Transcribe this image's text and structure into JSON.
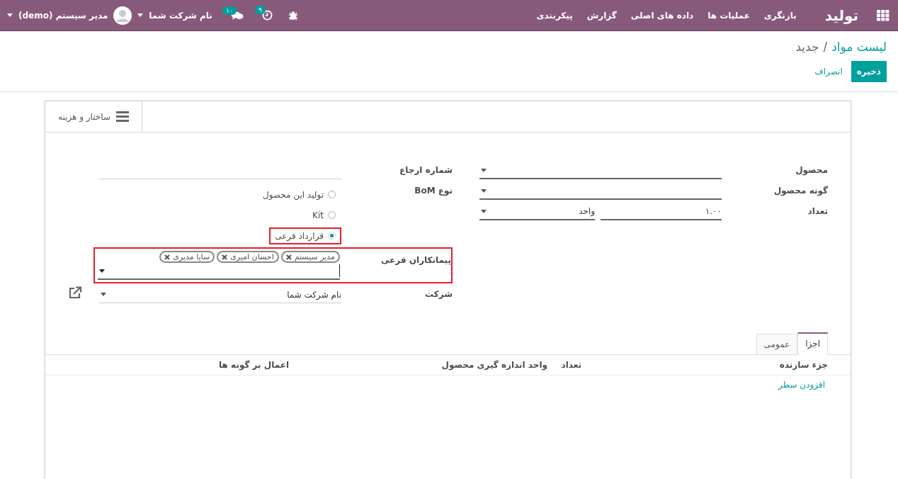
{
  "navbar": {
    "app_title": "تولید",
    "menu": [
      "بازنگری",
      "عملیات ها",
      "داده های اصلی",
      "گزارش",
      "پیکربندی"
    ],
    "activity_count": "۹",
    "message_count": "۱۰",
    "company": "نام شرکت شما",
    "user": "مدیر سیستم (demo)"
  },
  "breadcrumb": {
    "parent": "لیست مواد",
    "separator": "/",
    "current": "جدید"
  },
  "actions": {
    "save": "ذخیره",
    "discard": "انصراف"
  },
  "smart_button": {
    "label": "ساختار و هزینه"
  },
  "fields_right": [
    {
      "kind": "select",
      "label": "محصول"
    },
    {
      "kind": "select",
      "label": "گونه محصول"
    },
    {
      "kind": "quantity",
      "label": "تعداد",
      "value": "۱.۰۰",
      "unit": "واحد"
    }
  ],
  "reference": {
    "label": "شماره ارجاع"
  },
  "bom_type": {
    "label": "نوع BoM",
    "options": [
      {
        "label": "تولید این محصول",
        "selected": false,
        "highlighted": false
      },
      {
        "label": "Kit",
        "selected": false,
        "highlighted": false
      },
      {
        "label": "قرارداد فرعی",
        "selected": true,
        "highlighted": true
      }
    ]
  },
  "subcontractors": {
    "label": "پیمانکاران فرعی",
    "highlighted": true,
    "tags": [
      "مدیر سیستم",
      "احسان امیری",
      "سایا مدیری"
    ]
  },
  "company": {
    "label": "شرکت",
    "value": "نام شرکت شما"
  },
  "tabs": [
    {
      "label": "اجزا",
      "selected": true
    },
    {
      "label": "عمومی",
      "selected": false
    }
  ],
  "table": {
    "columns": [
      "جزء سازنده",
      "تعداد",
      "واحد اندازه گیری محصول",
      "اعمال بر گونه ها"
    ],
    "add_line": "افزودن سطر"
  }
}
